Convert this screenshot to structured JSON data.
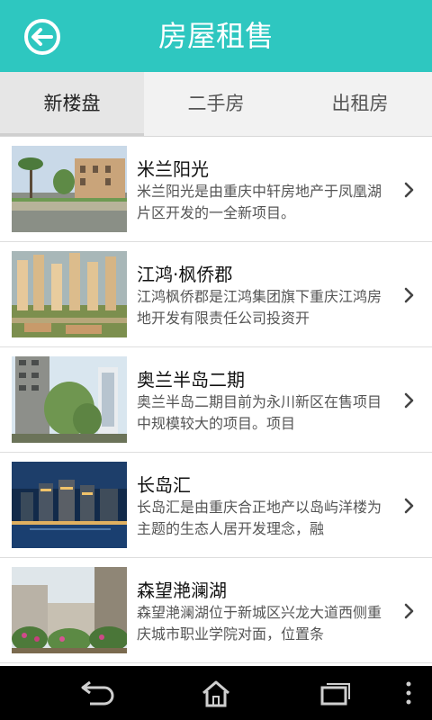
{
  "header": {
    "title": "房屋租售",
    "back_icon": "back-arrow-circle-icon"
  },
  "tabs": [
    {
      "label": "新楼盘",
      "active": true
    },
    {
      "label": "二手房",
      "active": false
    },
    {
      "label": "出租房",
      "active": false
    }
  ],
  "listings": [
    {
      "title": "米兰阳光",
      "desc": "米兰阳光是由重庆中轩房地产于凤凰湖片区开发的一全新项目。"
    },
    {
      "title": "江鸿·枫侨郡",
      "desc": "江鸿枫侨郡是江鸿集团旗下重庆江鸿房地开发有限责任公司投资开"
    },
    {
      "title": "奥兰半岛二期",
      "desc": "奥兰半岛二期目前为永川新区在售项目中规模较大的项目。项目"
    },
    {
      "title": "长岛汇",
      "desc": "长岛汇是由重庆合正地产以岛屿洋楼为主题的生态人居开发理念，融"
    },
    {
      "title": "森望滟澜湖",
      "desc": "森望滟澜湖位于新城区兴龙大道西侧重庆城市职业学院对面，位置条"
    }
  ],
  "colors": {
    "header_bg": "#2ec7c0",
    "nav_bg": "#000000"
  },
  "navbar": {
    "icons": [
      "back-icon",
      "home-icon",
      "recent-apps-icon",
      "menu-icon"
    ]
  }
}
